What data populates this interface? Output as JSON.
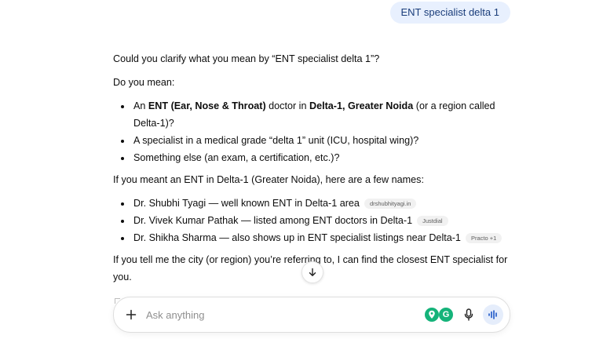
{
  "user_message": "ENT specialist delta 1",
  "reply": {
    "intro": "Could you clarify what you mean by “ENT specialist delta 1”?",
    "do_you_mean": "Do you mean:",
    "options": [
      {
        "pre": "An ",
        "bold1": "ENT (Ear, Nose & Throat)",
        "mid": " doctor in ",
        "bold2": "Delta-1, Greater Noida",
        "post": " (or a region called Delta-1)?"
      },
      {
        "text": "A specialist in a medical grade “delta 1” unit (ICU, hospital wing)?"
      },
      {
        "text": "Something else (an exam, a certification, etc.)?"
      }
    ],
    "names_intro": "If you meant an ENT in Delta-1 (Greater Noida), here are a few names:",
    "names": [
      {
        "text": "Dr. Shubhi Tyagi — well known ENT in Delta-1 area",
        "source": "drshubhityagi.in"
      },
      {
        "text": "Dr. Vivek Kumar Pathak — listed among ENT doctors in Delta-1",
        "source": "Justdial"
      },
      {
        "text": "Dr. Shikha Sharma — also shows up in ENT specialist listings near Delta-1",
        "source": "Practo +1"
      }
    ],
    "closing": "If you tell me the city (or region) you’re referring to, I can find the closest ENT specialist for you."
  },
  "composer": {
    "placeholder": "Ask anything",
    "value": ""
  },
  "icons": {
    "plus": "plus-icon",
    "scroll": "arrow-down-icon",
    "ext1": "map-pin-icon",
    "ext2": "grammarly-icon",
    "mic": "microphone-icon",
    "voice": "voice-waveform-icon"
  },
  "colors": {
    "user_bubble_bg": "#e8f0fe",
    "accent": "#15b37a",
    "voice_button_bg": "#e5edfb"
  },
  "ext2_letter": "G"
}
